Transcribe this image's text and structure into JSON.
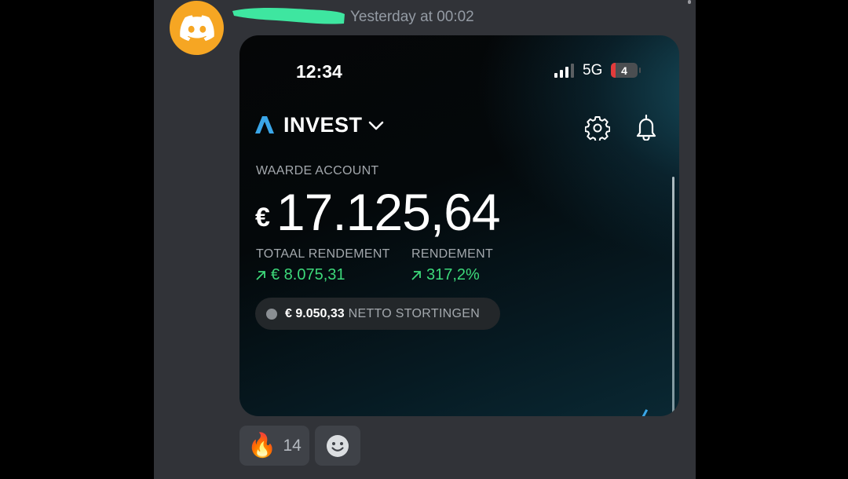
{
  "message": {
    "timestamp": "Yesterday at 00:02",
    "avatar_icon": "discord-logo-icon",
    "avatar_color": "#f6a623",
    "username_redaction_color": "#3ee6a0"
  },
  "phone": {
    "status_bar": {
      "time": "12:34",
      "network": "5G",
      "battery": "4"
    },
    "app": {
      "title": "INVEST",
      "account_label": "WAARDE ACCOUNT",
      "currency_symbol": "€",
      "account_value": "17.125,64",
      "total_return_label": "TOTAAL RENDEMENT",
      "total_return_value": "€ 8.075,31",
      "return_label": "RENDEMENT",
      "return_value": "317,2%",
      "net_deposits_amount": "€ 9.050,33",
      "net_deposits_label": "NETTO STORTINGEN",
      "positive_color": "#3dd97a",
      "accent_color": "#3aa6e8"
    }
  },
  "reactions": [
    {
      "emoji": "🔥",
      "count": "14"
    },
    {
      "icon": "add-reaction-smiley-icon"
    }
  ]
}
